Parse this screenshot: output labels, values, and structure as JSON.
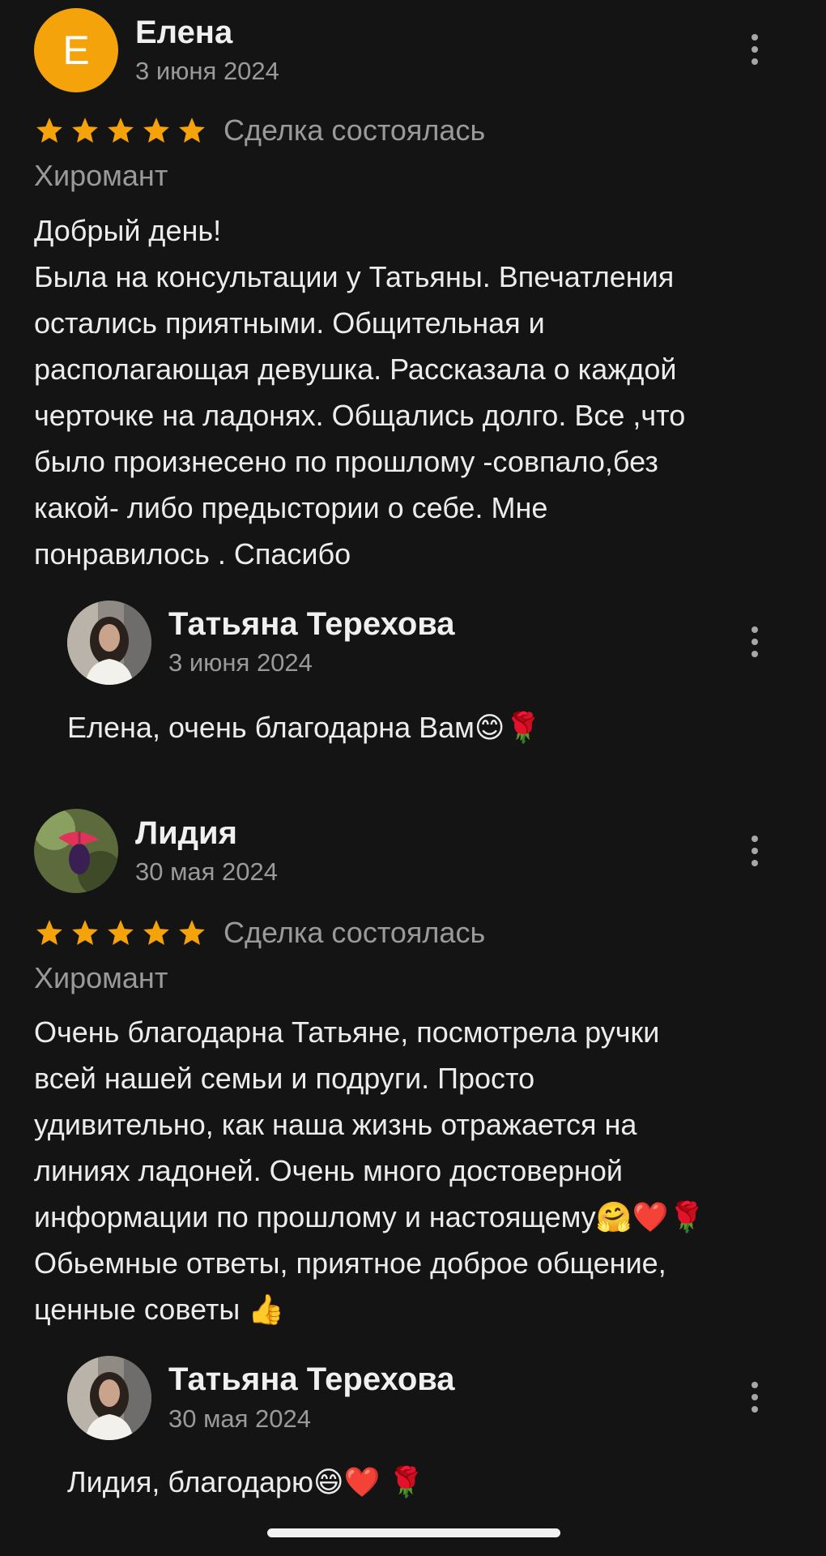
{
  "reviews": [
    {
      "author": "Елена",
      "avatar_letter": "Е",
      "date": "3 июня 2024",
      "stars": 5,
      "status": "Сделка состоялась",
      "category": "Хиромант",
      "text_lines": [
        "Добрый день!",
        "Была на консультации у Татьяны. Впечатления",
        "остались приятными. Общительная и",
        "располагающая девушка. Рассказала о каждой",
        "черточке на ладонях. Общались долго.  Все ,что",
        "было произнесено по прошлому -совпало,без",
        "какой- либо предыстории о себе.  Мне",
        "понравилось . Спасибо"
      ],
      "reply": {
        "author": "Татьяна Терехова",
        "date": "3 июня 2024",
        "text": "Елена, очень благодарна Вам😊🌹"
      }
    },
    {
      "author": "Лидия",
      "date": "30 мая 2024",
      "stars": 5,
      "status": "Сделка состоялась",
      "category": "Хиромант",
      "text_lines": [
        "Очень благодарна Татьяне, посмотрела ручки",
        "всей нашей семьи и подруги. Просто",
        "удивительно, как наша жизнь отражается на",
        "линиях ладоней. Очень много достоверной",
        "информации по прошлому и настоящему🤗❤️🌹",
        "Обьемные ответы, приятное доброе общение,",
        "ценные советы 👍"
      ],
      "reply": {
        "author": "Татьяна Терехова",
        "date": "30 мая 2024",
        "text": "Лидия, благодарю😄❤️ 🌹"
      }
    }
  ],
  "colors": {
    "background": "#141414",
    "star": "#f5a30a",
    "avatar_letter_bg": "#f5a30a",
    "secondary_text": "#9a9a9a",
    "primary_text": "#ececec"
  },
  "icons": {
    "star": "star-icon",
    "more": "more-vertical-icon"
  }
}
